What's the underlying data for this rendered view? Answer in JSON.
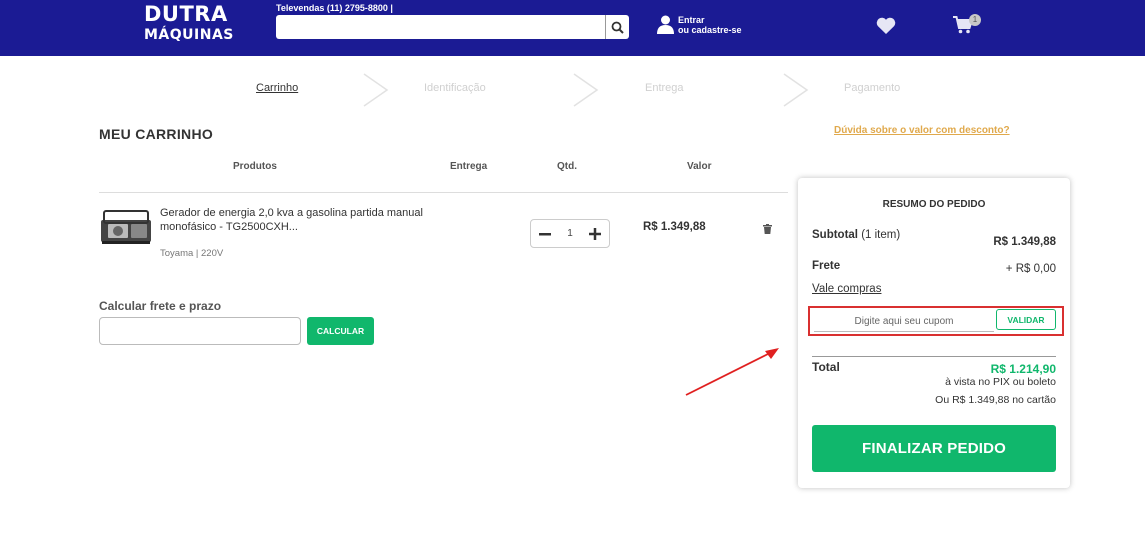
{
  "header": {
    "logo_line1": "DUTRA",
    "logo_line2": "MÁQUINAS",
    "televendas": "Televendas (11) 2795-8800  |",
    "search_placeholder": "",
    "login_line1": "Entrar",
    "login_line2": "ou cadastre-se",
    "cart_count": "1"
  },
  "steps": [
    "Carrinho",
    "Identificação",
    "Entrega",
    "Pagamento"
  ],
  "cart": {
    "title": "MEU CARRINHO",
    "help_link": "Dúvida sobre o valor com desconto?",
    "columns": {
      "products": "Produtos",
      "delivery": "Entrega",
      "qty": "Qtd.",
      "value": "Valor"
    },
    "item": {
      "name": "Gerador de energia 2,0 kva a gasolina partida manual monofásico - TG2500CXH...",
      "brand_variant": "Toyama | 220V",
      "quantity": "1",
      "price": "R$ 1.349,88"
    },
    "shipping": {
      "title": "Calcular frete e prazo",
      "button": "CALCULAR"
    }
  },
  "summary": {
    "title": "RESUMO DO PEDIDO",
    "subtotal_label": "Subtotal",
    "subtotal_count": "(1 item)",
    "subtotal_value": "R$ 1.349,88",
    "frete_label": "Frete",
    "frete_value": "+ R$ 0,00",
    "vale_label": "Vale compras",
    "coupon_placeholder": "Digite aqui seu cupom",
    "validar": "VALIDAR",
    "total_label": "Total",
    "total_value": "R$ 1.214,90",
    "total_pix": "à vista no PIX ou boleto",
    "total_card": "Ou R$ 1.349,88 no cartão",
    "finalize": "FINALIZAR PEDIDO"
  },
  "colors": {
    "header_bg": "#1b1b94",
    "accent_green": "#10b76c",
    "link_orange": "#e0a94c",
    "highlight_red": "#d93030"
  }
}
